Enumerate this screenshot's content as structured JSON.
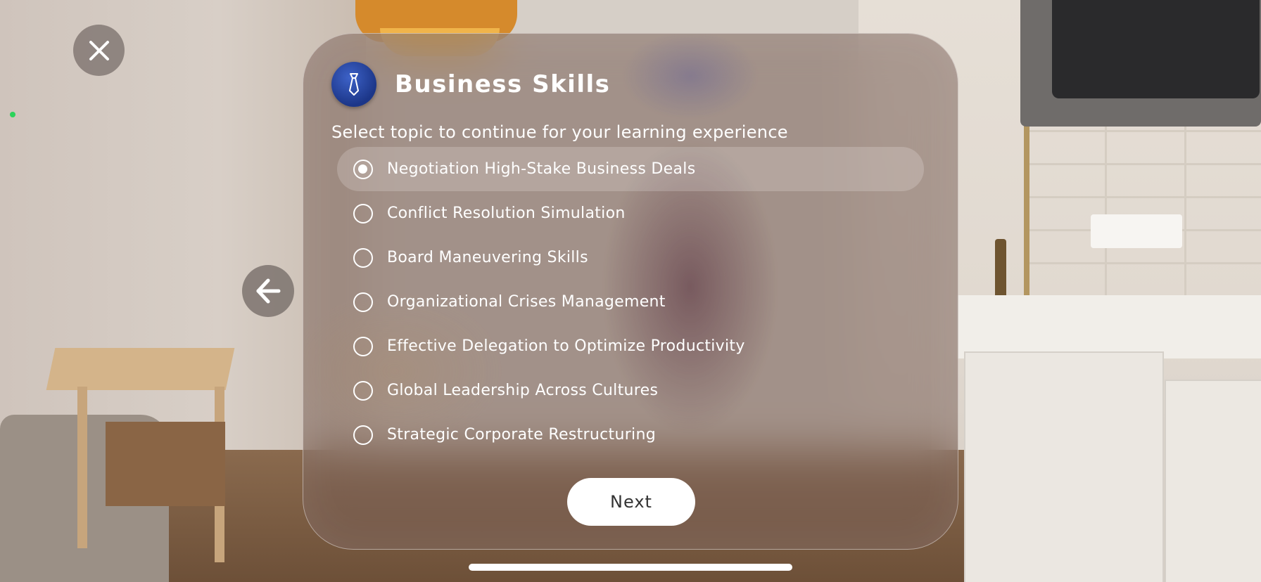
{
  "panel": {
    "icon": "necktie-icon",
    "title": "Business Skills",
    "subtitle": "Select topic to continue for your learning experience"
  },
  "topics": [
    {
      "label": "Negotiation High-Stake Business Deals",
      "selected": true
    },
    {
      "label": "Conflict Resolution Simulation",
      "selected": false
    },
    {
      "label": "Board Maneuvering Skills",
      "selected": false
    },
    {
      "label": "Organizational Crises Management",
      "selected": false
    },
    {
      "label": "Effective Delegation to Optimize Productivity",
      "selected": false
    },
    {
      "label": "Global Leadership Across Cultures",
      "selected": false
    },
    {
      "label": "Strategic Corporate Restructuring",
      "selected": false
    }
  ],
  "buttons": {
    "next_label": "Next",
    "close_icon": "close-icon",
    "back_icon": "arrow-left-icon"
  },
  "colors": {
    "badge": "#2a4aa8",
    "accent": "#ffffff"
  }
}
